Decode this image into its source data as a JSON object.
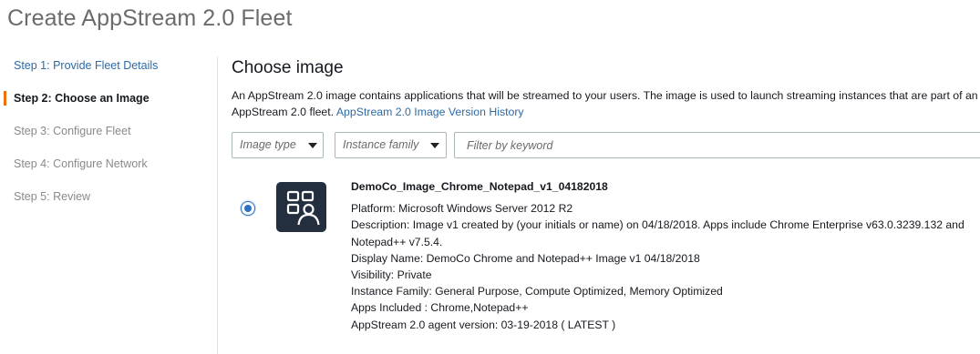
{
  "page": {
    "title": "Create AppStream 2.0 Fleet"
  },
  "steps": [
    {
      "label": "Step 1: Provide Fleet Details",
      "state": "link"
    },
    {
      "label": "Step 2: Choose an Image",
      "state": "active"
    },
    {
      "label": "Step 3: Configure Fleet",
      "state": "disabled"
    },
    {
      "label": "Step 4: Configure Network",
      "state": "disabled"
    },
    {
      "label": "Step 5: Review",
      "state": "disabled"
    }
  ],
  "main": {
    "title": "Choose image",
    "description": "An AppStream 2.0 image contains applications that will be streamed to your users. The image is used to launch streaming instances that are part of an",
    "description_line2": "AppStream 2.0 fleet.",
    "history_link": "AppStream 2.0 Image Version History"
  },
  "filters": {
    "image_type": "Image type",
    "instance_family": "Instance family",
    "keyword_placeholder": "Filter by keyword"
  },
  "image": {
    "selected": true,
    "icon": "appstream-image-icon",
    "name": "DemoCo_Image_Chrome_Notepad_v1_04182018",
    "platform": "Platform: Microsoft Windows Server 2012 R2",
    "description_line1": "Description: Image v1 created by (your initials or name) on 04/18/2018. Apps include Chrome Enterprise v63.0.3239.132 and",
    "description_line2": "Notepad++ v7.5.4.",
    "display_name": "Display Name: DemoCo Chrome and Notepad++ Image v1 04/18/2018",
    "visibility": "Visibility: Private",
    "instance_family": "Instance Family: General Purpose, Compute Optimized, Memory Optimized",
    "apps_included": "Apps Included : Chrome,Notepad++",
    "agent_version": "AppStream 2.0 agent version: 03-19-2018 ( LATEST )"
  },
  "colors": {
    "accent": "#ec7211",
    "link": "#2d6aa6",
    "icon_bg": "#232f3e",
    "radio": "#2d72c4"
  }
}
